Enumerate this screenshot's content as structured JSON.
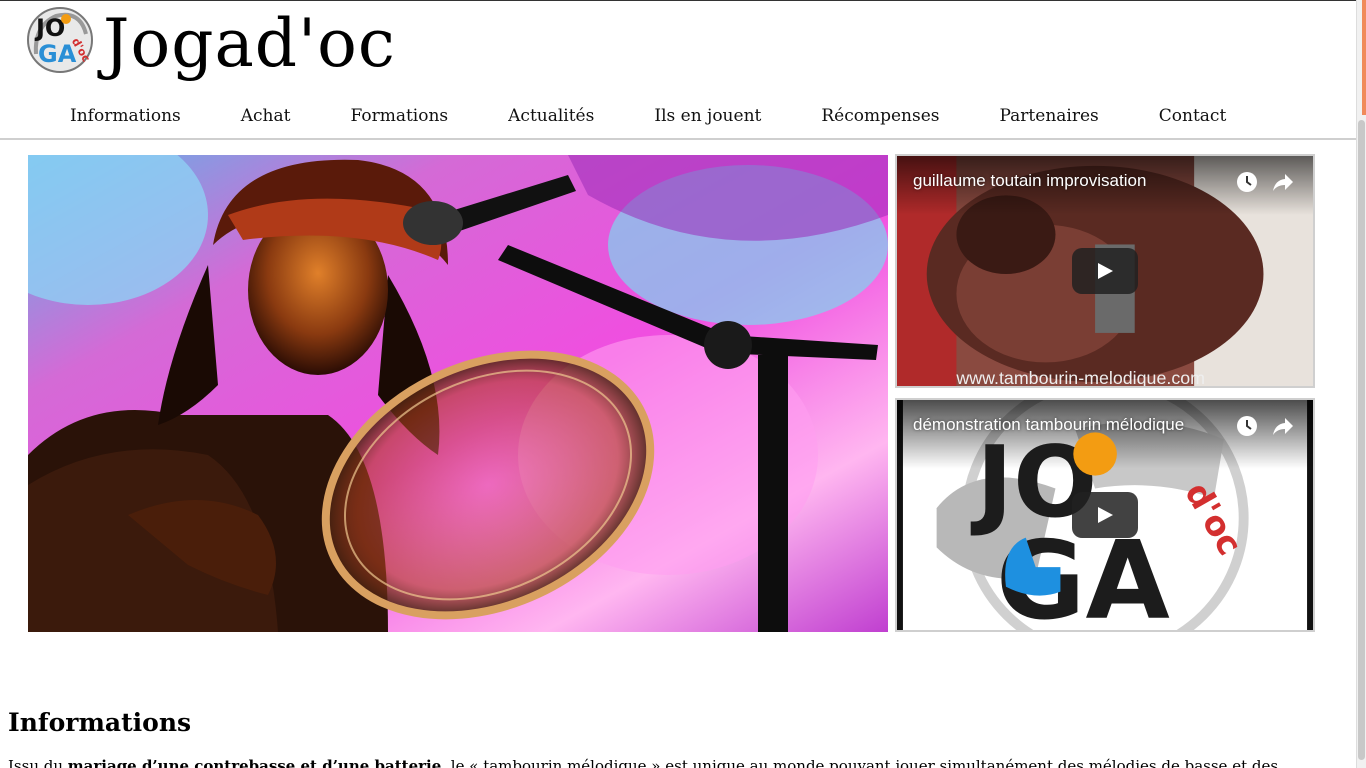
{
  "site": {
    "title": "Jogad'oc",
    "logo_text": [
      "JO",
      "GA",
      "d'oc"
    ]
  },
  "nav": {
    "items": [
      {
        "label": "Informations"
      },
      {
        "label": "Achat"
      },
      {
        "label": "Formations"
      },
      {
        "label": "Actualités"
      },
      {
        "label": "Ils en jouent"
      },
      {
        "label": "Récompenses"
      },
      {
        "label": "Partenaires"
      },
      {
        "label": "Contact"
      }
    ]
  },
  "videos": [
    {
      "title": "guillaume toutain improvisation",
      "watermark": "www.tambourin-melodique.com"
    },
    {
      "title": "démonstration tambourin mélodique",
      "logo_text": [
        "JO",
        "GA",
        "d'oc"
      ]
    }
  ],
  "content": {
    "section_title": "Informations",
    "intro_start": "Issu du ",
    "intro_bold": "mariage d’une contrebasse et d’une batterie",
    "intro_rest": ", le « tambourin mélodique » est unique au monde pouvant jouer simultanément des mélodies de basse et des"
  },
  "colors": {
    "accent": "#f08a5a",
    "nav_border": "#cfcfcf",
    "logo_blue": "#2a8fd6",
    "logo_orange": "#f39c12",
    "logo_red": "#d32f2f"
  }
}
